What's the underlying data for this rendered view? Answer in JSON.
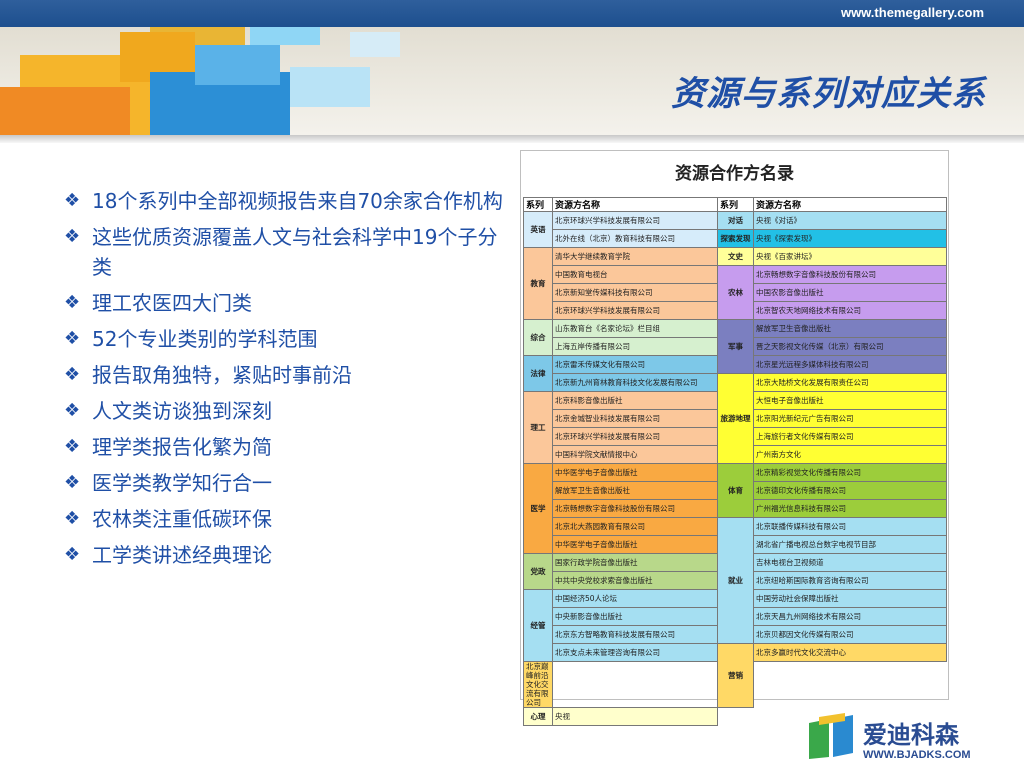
{
  "site_url": "www.themegallery.com",
  "slide_title": "资源与系列对应关系",
  "bullets": [
    "18个系列中全部视频报告来自70余家合作机构",
    "这些优质资源覆盖人文与社会科学中19个子分类",
    "理工农医四大门类",
    "52个专业类别的学科范围",
    "报告取角独特，紧贴时事前沿",
    "人文类访谈独到深刻",
    "理学类报告化繁为简",
    "医学类教学知行合一",
    "农林类注重低碳环保",
    "工学类讲述经典理论"
  ],
  "table": {
    "title": "资源合作方名录",
    "headers": [
      "系列",
      "资源方名称",
      "系列",
      "资源方名称"
    ],
    "left_groups": [
      {
        "series": "英语",
        "color": "#d6ecfa",
        "rows": [
          "北京环球兴学科技发展有限公司",
          "北外在线（北京）教育科技有限公司"
        ]
      },
      {
        "series": "教育",
        "color": "#fbc79a",
        "rows": [
          "清华大学继续教育学院",
          "中国教育电视台",
          "北京新知堂传媒科技有限公司",
          "北京环球兴学科技发展有限公司"
        ]
      },
      {
        "series": "综合",
        "color": "#d6f0cf",
        "rows": [
          "山东教育台《名家论坛》栏目组",
          "上海五岸传播有限公司"
        ]
      },
      {
        "series": "法律",
        "color": "#7dc8e8",
        "rows": [
          "北京雷禾传媒文化有限公司",
          "北京新九州育林教育科技文化发展有限公司"
        ]
      },
      {
        "series": "理工",
        "color": "#fbc79a",
        "rows": [
          "北京科影音像出版社",
          "北京金城智业科技发展有限公司",
          "北京环球兴学科技发展有限公司",
          "中国科学院文献情报中心"
        ]
      },
      {
        "series": "医学",
        "color": "#f9a942",
        "rows": [
          "中华医学电子音像出版社",
          "解放军卫生音像出版社",
          "北京畅想数字音像科技股份有限公司",
          "北京北大燕园教育有限公司",
          "中华医学电子音像出版社"
        ]
      },
      {
        "series": "党政",
        "color": "#b8d88a",
        "rows": [
          "国家行政学院音像出版社",
          "中共中央党校求索音像出版社"
        ]
      },
      {
        "series": "经管",
        "color": "#a5dff2",
        "rows": [
          "中国经济50人论坛",
          "中央新影音像出版社",
          "北京东方智略教育科技发展有限公司",
          "北京支点未来管理咨询有限公司"
        ]
      }
    ],
    "right_groups": [
      {
        "series": "对话",
        "color": "#a5dff2",
        "rows": [
          "央视《对话》"
        ]
      },
      {
        "series": "探索发现",
        "color": "#22c0e6",
        "rows": [
          "央视《探索发现》"
        ]
      },
      {
        "series": "文史",
        "color": "#ffff99",
        "rows": [
          "央视《百家讲坛》"
        ]
      },
      {
        "series": "农林",
        "color": "#c69cee",
        "rows": [
          "北京畅想数字音像科技股份有限公司",
          "中国农影音像出版社",
          "北京智农天地网络技术有限公司"
        ]
      },
      {
        "series": "军事",
        "color": "#7b7fc0",
        "rows": [
          "解放军卫生音像出版社",
          "晋之天影视文化传媒（北京）有限公司",
          "北京星光远程多媒体科技有限公司"
        ]
      },
      {
        "series": "旅游地理",
        "color": "#ffff33",
        "rows": [
          "北京大陆桥文化发展有限责任公司",
          "大恒电子音像出版社",
          "北京阳光新纪元广告有限公司",
          "上海旅行者文化传媒有限公司",
          "广州南方文化"
        ]
      },
      {
        "series": "体育",
        "color": "#9ccd3b",
        "rows": [
          "北京精彩视觉文化传播有限公司",
          "北京德印文化传播有限公司",
          "广州福光信息科技有限公司"
        ]
      },
      {
        "series": "就业",
        "color": "#a5dff2",
        "rows": [
          "北京联播传媒科技有限公司",
          "湖北省广播电视总台数字电视节目部",
          "吉林电视台卫视频道",
          "北京纽哈斯国际教育咨询有限公司",
          "中国劳动社会保障出版社",
          "北京天昌九州网络技术有限公司",
          "北京贝都因文化传媒有限公司"
        ]
      },
      {
        "series": "营销",
        "color": "#ffd966",
        "rows": [
          "北京多赢时代文化交流中心",
          "北京巅峰前沿文化交流有限公司"
        ]
      },
      {
        "series": "心理",
        "color": "#ffffcc",
        "rows": [
          "央视"
        ]
      }
    ]
  },
  "logo": {
    "text": "爱迪科森",
    "url": "WWW.BJADKS.COM",
    "icon": "book-logo-icon"
  }
}
